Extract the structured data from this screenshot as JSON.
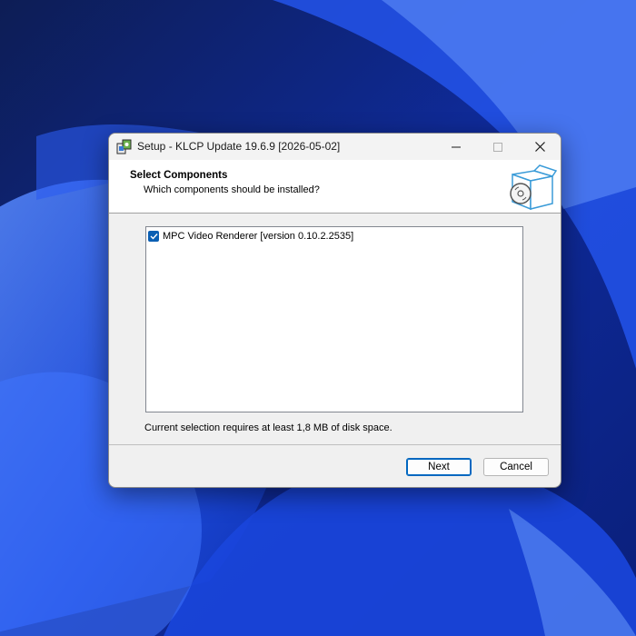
{
  "window": {
    "title": "Setup - KLCP Update 19.6.9 [2026-05-02]",
    "controls": {
      "minimize": "minimize",
      "maximize": "maximize",
      "close": "close"
    }
  },
  "header": {
    "title": "Select Components",
    "subtitle": "Which components should be installed?",
    "icon": "setup-box-icon"
  },
  "components": [
    {
      "label": "MPC Video Renderer [version 0.10.2.2535]",
      "checked": true
    }
  ],
  "disk_space": "Current selection requires at least 1,8 MB of disk space.",
  "buttons": {
    "next": "Next",
    "cancel": "Cancel"
  },
  "colors": {
    "accent": "#0b5fb3",
    "wallpaper": "#1e4be0"
  }
}
